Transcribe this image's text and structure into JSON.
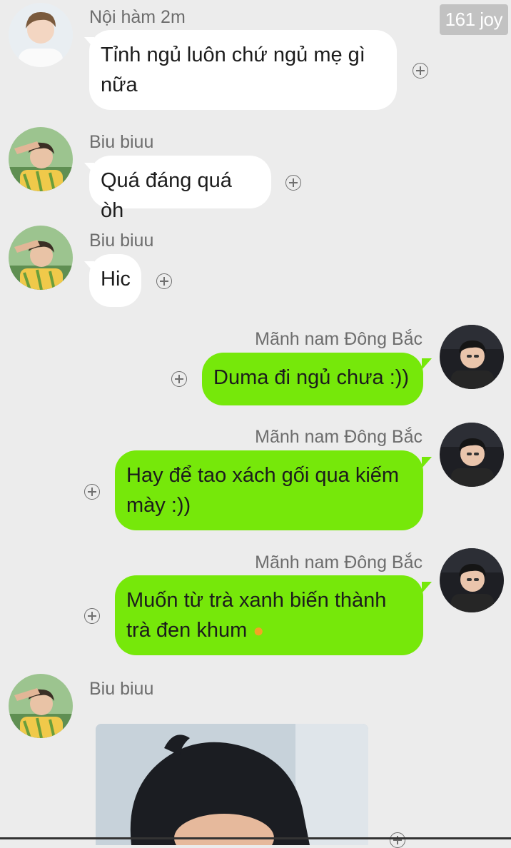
{
  "watermark": "161 joy",
  "messages": [
    {
      "sender": "Nội hàm 2m",
      "text": "Tỉnh ngủ luôn chứ ngủ mẹ gì nữa",
      "line1": "Tỉnh ngủ luôn chứ ngủ mẹ gì",
      "line2": "nữa",
      "direction": "incoming"
    },
    {
      "sender": "Biu biuu",
      "text": "Quá đáng quá òh",
      "direction": "incoming"
    },
    {
      "sender": "Biu biuu",
      "text": "Hic",
      "direction": "incoming"
    },
    {
      "sender": "Mãnh nam Đông Bắc",
      "text": "Duma đi ngủ chưa :))",
      "direction": "outgoing"
    },
    {
      "sender": "Mãnh nam Đông Bắc",
      "text": "Hay để tao xách gối qua kiếm mày :))",
      "line1": "Hay để tao xách gối qua kiếm",
      "line2": "mày :))",
      "direction": "outgoing"
    },
    {
      "sender": "Mãnh nam Đông Bắc",
      "text": "Muốn từ trà xanh biến thành trà đen khum",
      "line1": "Muốn từ trà xanh biến thành",
      "line2": "trà đen khum",
      "emoji": "fist-icon",
      "direction": "outgoing"
    },
    {
      "sender": "Biu biuu",
      "type": "image",
      "direction": "incoming"
    }
  ],
  "colors": {
    "background": "#ececec",
    "incoming_bubble": "#ffffff",
    "outgoing_bubble": "#76e80a",
    "sender_text": "#6d6d6d"
  },
  "icons": [
    "plus-circle-icon",
    "avatar",
    "fist-icon"
  ]
}
